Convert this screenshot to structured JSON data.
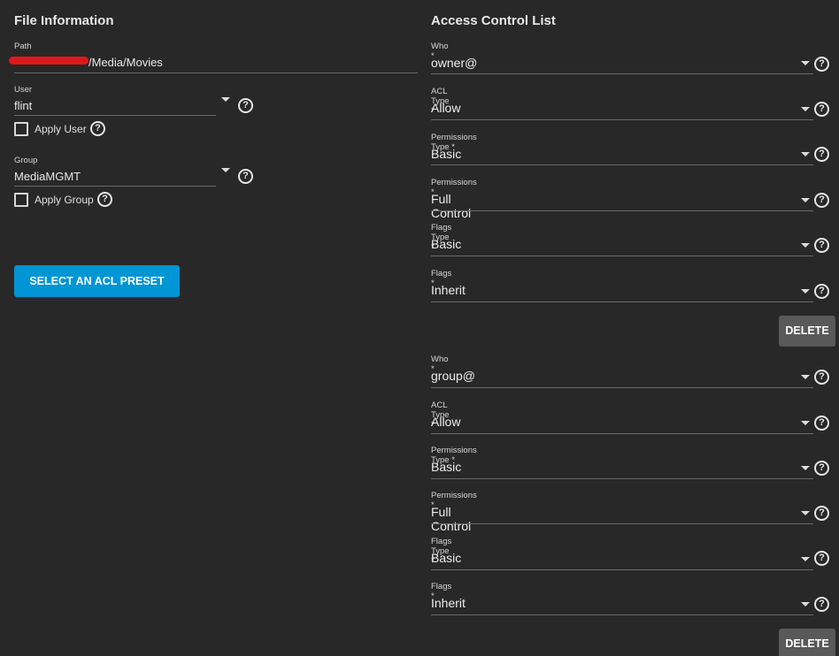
{
  "file_info": {
    "title": "File Information",
    "path": {
      "label": "Path",
      "value": "/Media/Movies"
    },
    "user": {
      "label": "User",
      "value": "flint",
      "apply_label": "Apply User"
    },
    "group": {
      "label": "Group",
      "value": "MediaMGMT",
      "apply_label": "Apply Group"
    },
    "preset_button": "SELECT AN ACL PRESET"
  },
  "acl": {
    "title": "Access Control List",
    "delete_label": "DELETE",
    "entries": [
      {
        "who_label": "Who *",
        "who": "owner@",
        "acl_type_label": "ACL Type *",
        "acl_type": "Allow",
        "perm_type_label": "Permissions Type *",
        "perm_type": "Basic",
        "perm_label": "Permissions *",
        "perm": "Full Control",
        "flags_type_label": "Flags Type *",
        "flags_type": "Basic",
        "flags_label": "Flags *",
        "flags": "Inherit"
      },
      {
        "who_label": "Who *",
        "who": "group@",
        "acl_type_label": "ACL Type *",
        "acl_type": "Allow",
        "perm_type_label": "Permissions Type *",
        "perm_type": "Basic",
        "perm_label": "Permissions *",
        "perm": "Full Control",
        "flags_type_label": "Flags Type *",
        "flags_type": "Basic",
        "flags_label": "Flags *",
        "flags": "Inherit"
      }
    ]
  },
  "icons": {
    "help": "help-circle-icon",
    "dropdown": "caret-down-icon",
    "checkbox": "checkbox-unchecked-icon"
  },
  "colors": {
    "background": "#282828",
    "primary_button": "#0095d5",
    "delete_button": "#595959",
    "redaction": "#e0171a"
  }
}
